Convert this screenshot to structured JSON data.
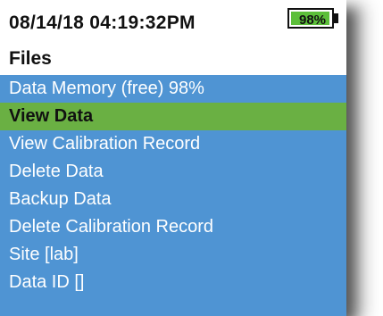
{
  "status": {
    "datetime": "08/14/18 04:19:32PM",
    "battery_label": "98%",
    "battery_level": 0.98,
    "battery_color": "#5cbf3a"
  },
  "title": "Files",
  "menu": {
    "background_color": "#4f94d3",
    "selected_color": "#6ab043",
    "selected_index": 1,
    "items": [
      {
        "label": "Data Memory (free) 98%"
      },
      {
        "label": "View Data"
      },
      {
        "label": "View Calibration Record"
      },
      {
        "label": "Delete Data"
      },
      {
        "label": "Backup Data"
      },
      {
        "label": "Delete Calibration Record"
      },
      {
        "label": "Site [lab]"
      },
      {
        "label": "Data ID []"
      }
    ]
  }
}
